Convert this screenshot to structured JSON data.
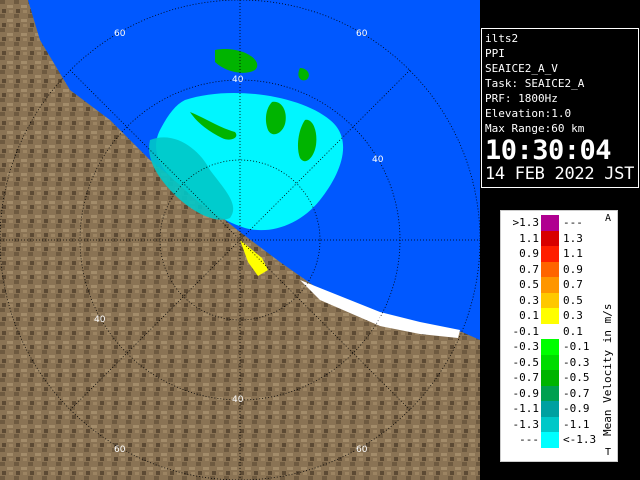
{
  "info": {
    "station": "ilts2",
    "mode": "PPI",
    "product": "SEAICE2_A_V",
    "task": "Task: SEAICE2_A",
    "prf": "PRF: 1800Hz",
    "elevation": "Elevation:1.0",
    "max_range": "Max Range:60 km",
    "time": "10:30:04",
    "date": "14 FEB 2022 JST"
  },
  "map": {
    "range_labels": [
      "60",
      "40",
      "40",
      "40",
      "40",
      "40",
      "60",
      "60",
      "60",
      "40",
      "60"
    ]
  },
  "legend": {
    "title": "Mean Velocity in m/s",
    "top_mark": "A",
    "bottom_mark": "T",
    "rows": [
      {
        "left": ">1.3",
        "right": "---",
        "color": "#b00090"
      },
      {
        "left": "1.1",
        "right": "1.3",
        "color": "#d80000"
      },
      {
        "left": "0.9",
        "right": "1.1",
        "color": "#ff1e00"
      },
      {
        "left": "0.7",
        "right": "0.9",
        "color": "#ff6400"
      },
      {
        "left": "0.5",
        "right": "0.7",
        "color": "#ff9600"
      },
      {
        "left": "0.3",
        "right": "0.5",
        "color": "#ffc800"
      },
      {
        "left": "0.1",
        "right": "0.3",
        "color": "#ffff00"
      },
      {
        "left": "-0.1",
        "right": "0.1",
        "color": "#ffffff"
      },
      {
        "left": "-0.3",
        "right": "-0.1",
        "color": "#00ff00"
      },
      {
        "left": "-0.5",
        "right": "-0.3",
        "color": "#00dc00"
      },
      {
        "left": "-0.7",
        "right": "-0.5",
        "color": "#00b400"
      },
      {
        "left": "-0.9",
        "right": "-0.7",
        "color": "#00a050"
      },
      {
        "left": "-1.1",
        "right": "-0.9",
        "color": "#00a0a0"
      },
      {
        "left": "-1.3",
        "right": "-1.1",
        "color": "#00c8c8"
      },
      {
        "left": "---",
        "right": "<-1.3",
        "color": "#00ffff"
      }
    ]
  }
}
